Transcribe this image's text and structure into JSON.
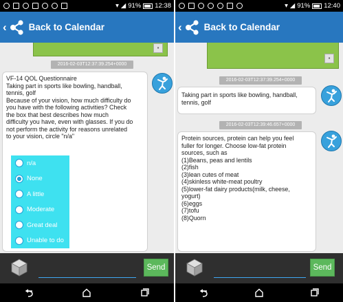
{
  "left_screen": {
    "status": {
      "battery_percent": "91%",
      "time": "12:38"
    },
    "appbar": {
      "title": "Back to Calendar"
    },
    "timestamp": "2016-02-03T12:37:39.254+0000",
    "question_lines": [
      "VF-14 QOL Questionnaire",
      "Taking part in sports like bowling, handball,",
      "tennis, golf",
      "Because of your vision, how much difficulty do",
      "you have with the following activities? Check",
      "the box that best describes how much",
      "difficulty you have, even with glasses. If you do",
      "not perform the activity for reasons unrelated",
      "to your vision, circle \"n/a\""
    ],
    "options": [
      {
        "label": "n/a",
        "selected": false
      },
      {
        "label": "None",
        "selected": true
      },
      {
        "label": "A little",
        "selected": false
      },
      {
        "label": "Moderate",
        "selected": false
      },
      {
        "label": "Great deal",
        "selected": false
      },
      {
        "label": "Unable to do",
        "selected": false
      }
    ],
    "send_label": "Send"
  },
  "right_screen": {
    "status": {
      "battery_percent": "91%",
      "time": "12:40"
    },
    "appbar": {
      "title": "Back to Calendar"
    },
    "timestamp_1": "2016-02-03T12:37:39.254+0000",
    "message_1_lines": [
      "Taking part in sports like bowling, handball,",
      "tennis, golf"
    ],
    "timestamp_2": "2016-02-03T12:39:46.657+0000",
    "message_2_lines": [
      "Protein sources, protein can help you feel",
      "fuller for longer. Choose low-fat protein",
      "sources, such as",
      " (1)Beans, peas and lentils",
      "(2)fish",
      "(3)lean cutes of meat",
      "(4)skinless white-meat poultry",
      "(5)lower-fat dairy products(milk, cheese,",
      "yogurt)",
      "(6)eggs",
      "(7)tofu",
      "(8)Quorn"
    ],
    "send_label": "Send"
  },
  "colors": {
    "appbar": "#2877bf",
    "options_panel": "#3ee1f0",
    "send_button": "#5cb85c",
    "card_green": "#8bc34a",
    "timestamp_bg": "#b3b3b3",
    "avatar": "#38a1dc"
  },
  "icons": {
    "back": "chevron-left-icon",
    "share": "share-icon",
    "attach": "cube-icon",
    "avatar": "figure-avatar-icon",
    "nav": [
      "back-nav-icon",
      "home-nav-icon",
      "recents-nav-icon"
    ]
  }
}
